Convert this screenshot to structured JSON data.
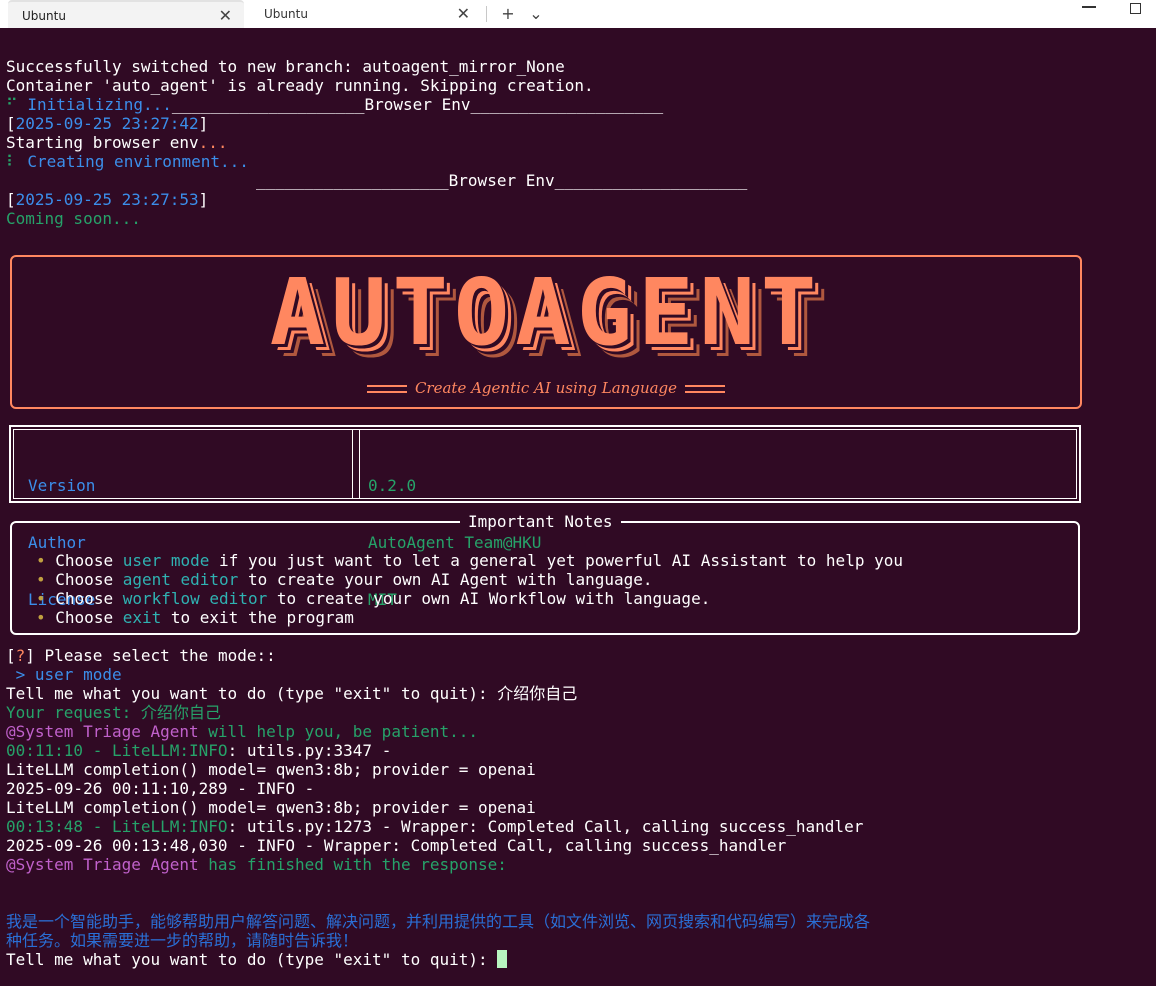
{
  "tabs": [
    {
      "label": "Ubuntu",
      "active": true
    },
    {
      "label": "Ubuntu",
      "active": false
    }
  ],
  "tab_controls": {
    "new_tab": "+",
    "dropdown": "⌄",
    "close": "✕"
  },
  "log": {
    "switched": "Successfully switched to new branch: autoagent_mirror_None",
    "container": "Container 'auto_agent' is already running. Skipping creation.",
    "spinner1": "⠋",
    "initializing": "Initializing...",
    "browser_env_header1": "____________________Browser Env____________________",
    "ts1_open": "[",
    "ts1": "2025-09-25 23:27:42",
    "ts1_close": "]",
    "starting": "Starting browser env",
    "starting_dots": "...",
    "spinner2": "⠇",
    "creating": "Creating environment...",
    "browser_env_header2": "____________________Browser Env____________________",
    "ts2": "2025-09-25 23:27:53",
    "coming_soon": "Coming soon..."
  },
  "banner": {
    "logo": "AUTOAGENT",
    "subtitle": "Create Agentic AI using Language"
  },
  "info": {
    "labels": [
      "Version",
      "Author",
      "License"
    ],
    "values": [
      "0.2.0",
      "AutoAgent Team@HKU",
      "MIT"
    ]
  },
  "notes": {
    "title": "Important Notes",
    "bullet": "•",
    "items": [
      {
        "pre": "Choose ",
        "key": "user mode",
        "post": " if you just want to let a general yet powerful AI Assistant to help you"
      },
      {
        "pre": "Choose ",
        "key": "agent editor",
        "post": " to create your own AI Agent with language."
      },
      {
        "pre": "Choose ",
        "key": "workflow editor",
        "post": " to create your own AI Workflow with language."
      },
      {
        "pre": "Choose ",
        "key": "exit",
        "post": " to exit the program"
      }
    ]
  },
  "session": {
    "select_prefix": "[",
    "select_q": "?",
    "select_text": "] Please select the mode::",
    "selected": " > user mode",
    "prompt1": "Tell me what you want to do (type \"exit\" to quit): ",
    "prompt1_input": "介绍你自己",
    "request_label": "Your request: ",
    "request_value": "介绍你自己",
    "agent_name": "@System Triage Agent",
    "help_text": " will help you, be patient...",
    "l1_time": "00:11:10",
    "l1_sep": " - ",
    "l1_src": "LiteLLM:INFO",
    "l1_rest": ": utils.py:3347 -",
    "l2": "LiteLLM completion() model= qwen3:8b; provider = openai",
    "l3": "2025-09-26 00:11:10,289 - INFO -",
    "l4": "LiteLLM completion() model= qwen3:8b; provider = openai",
    "l5_time": "00:13:48",
    "l5_src": "LiteLLM:INFO",
    "l5_rest": ": utils.py:1273 - Wrapper: Completed Call, calling success_handler",
    "l6": "2025-09-26 00:13:48,030 - INFO - Wrapper: Completed Call, calling success_handler",
    "finished_agent": "@System Triage Agent",
    "finished_text": " has finished with the response:",
    "response_line1": "我是一个智能助手，能够帮助用户解答问题、解决问题，并利用提供的工具（如文件浏览、网页搜索和代码编写）来完成各",
    "response_line2": "种任务。如果需要进一步的帮助，请随时告诉我！",
    "prompt2": "Tell me what you want to do (type \"exit\" to quit): "
  },
  "colors": {
    "background": "#300a24",
    "accent_orange": "#ff8760",
    "blue": "#3b8eea",
    "teal": "#2fb2b2",
    "green": "#26a269",
    "magenta": "#c061cb"
  }
}
